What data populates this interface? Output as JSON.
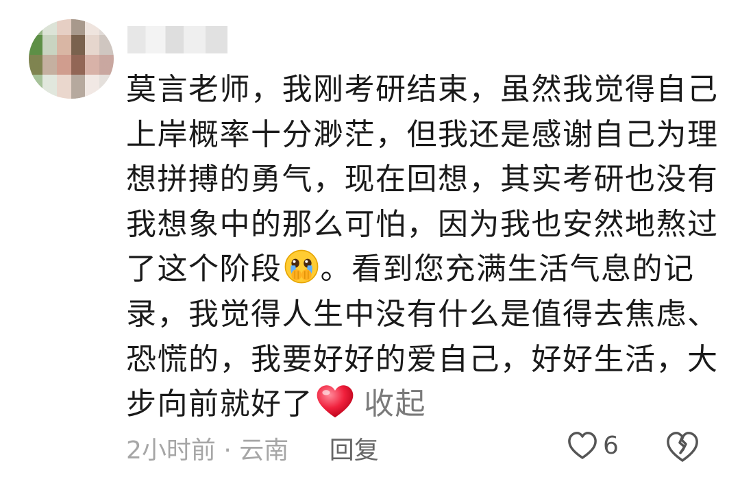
{
  "comment": {
    "lines": [
      "莫言老师，我刚考研结束，虽然我觉得自己",
      "上岸概率十分渺茫，但我还是感谢自己为理",
      "想拼搏的勇气，现在回想，其实考研也没有",
      "我想象中的那么可怕，因为我也安然地熬过",
      "了这个阶段",
      "。看到您充满生活气息的记",
      "录，我觉得人生中没有什么是值得去焦虑、",
      "恐慌的，我要好好的爱自己，好好生活，大",
      "步向前就好了"
    ],
    "collapse_label": "收起",
    "emojis": [
      "crying-face-emoji",
      "red-heart-emoji"
    ]
  },
  "meta": {
    "time_location": "2小时前 · 云南",
    "reply_label": "回复"
  },
  "actions": {
    "like_count": "6",
    "icons": [
      "heart-outline-icon",
      "broken-heart-icon"
    ]
  }
}
